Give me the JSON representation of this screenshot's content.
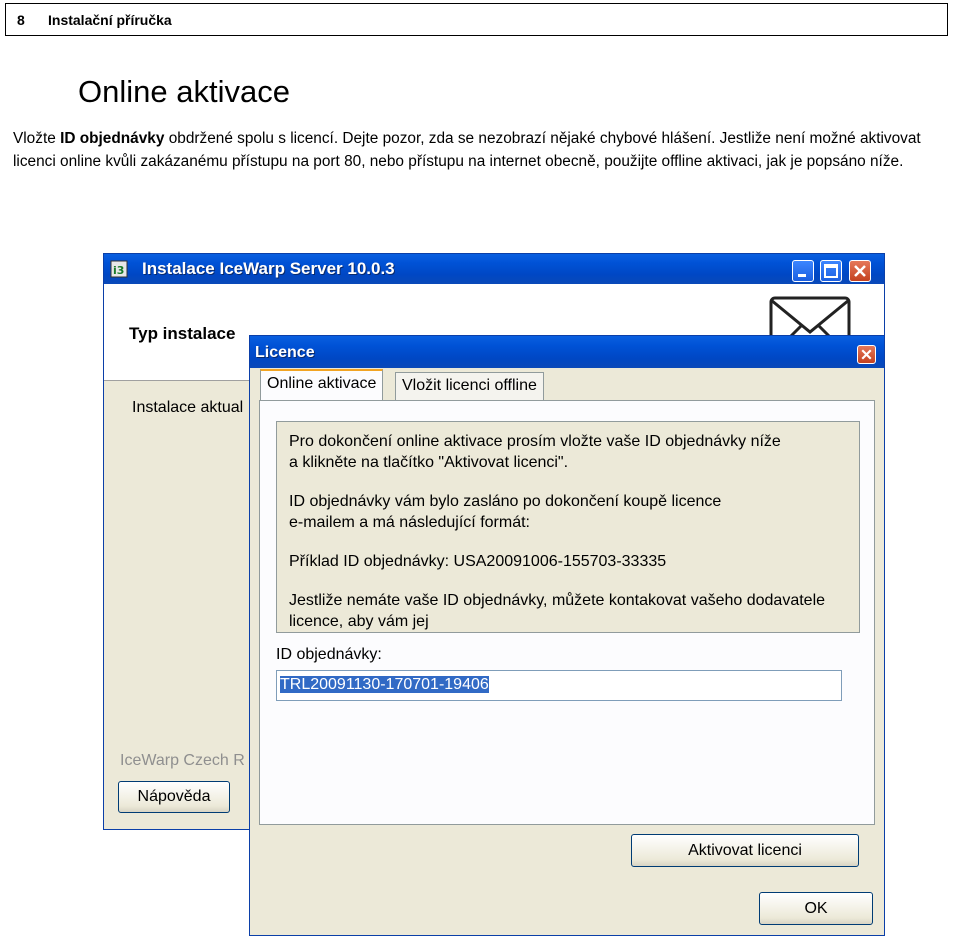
{
  "document": {
    "page_number": "8",
    "header_title": "Instalační příručka",
    "section_title": "Online aktivace",
    "paragraph": {
      "pre": "Vložte ",
      "bold": "ID objednávky",
      "post": " obdržené spolu s licencí. Dejte pozor, zda se nezobrazí nějaké chybové hlášení. Jestliže není možné aktivovat licenci online kvůli zakázanému přístupu na port 80, nebo přístupu na internet obecně, použijte offline aktivaci, jak je popsáno níže."
    }
  },
  "installer_window": {
    "title": "Instalace IceWarp Server 10.0.3",
    "section_heading": "Typ instalace",
    "install_text": "Instalace aktual",
    "company_text": "IceWarp Czech R",
    "help_button": "Nápověda",
    "icons": [
      "app-icon",
      "minimize-icon",
      "maximize-icon",
      "close-icon",
      "envelope-icon"
    ]
  },
  "licence_dialog": {
    "title": "Licence",
    "tabs": [
      {
        "label": "Online aktivace",
        "active": true
      },
      {
        "label": "Vložit licenci offline",
        "active": false
      }
    ],
    "info": {
      "line1": "Pro dokončení online aktivace prosím vložte vaše ID objednávky níže",
      "line2": "a klikněte na tlačítko \"Aktivovat licenci\".",
      "line3": "ID objednávky vám bylo zasláno po dokončení koupě licence",
      "line4": "e-mailem a má následující formát:",
      "line5": "Příklad ID objednávky: USA20091006-155703-33335",
      "line6": "Jestliže nemáte vaše ID objednávky, můžete kontakovat vašeho dodavatele",
      "line7": "licence, aby vám jej"
    },
    "id_label": "ID objednávky:",
    "id_value": "TRL20091130-170701-19406",
    "activate_button": "Aktivovat licenci",
    "ok_button": "OK"
  },
  "colors": {
    "titlebar": "#0052d6",
    "dialog_bg": "#ece9d8",
    "selection": "#316ac5",
    "tab_highlight": "#f2a422"
  }
}
